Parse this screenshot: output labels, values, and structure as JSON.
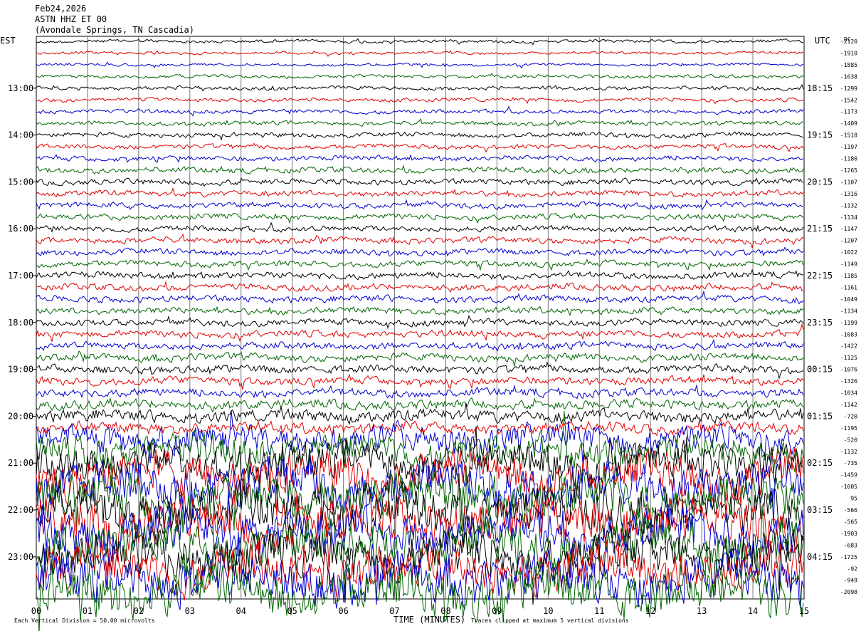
{
  "header": {
    "date": "Feb24,2026",
    "station": "ASTN HHZ ET 00",
    "location": "(Avondale Springs, TN Cascadia)"
  },
  "labels": {
    "left_tz": "EST",
    "right_tz": "UTC",
    "dc": "DC",
    "x_title": "TIME (MINUTES)",
    "footer_left": "Each Vertical Division = 50.00 microvolts",
    "footer_right": "Traces clipped at maximum 5 vertical divisions"
  },
  "chart_data": {
    "type": "line",
    "title": "ASTN HHZ ET 00",
    "xlabel": "TIME (MINUTES)",
    "ylabel": "",
    "xlim": [
      0,
      15
    ],
    "grid": true,
    "x_ticks": [
      "00",
      "01",
      "02",
      "03",
      "04",
      "05",
      "06",
      "07",
      "08",
      "09",
      "10",
      "11",
      "12",
      "13",
      "14",
      "15"
    ],
    "left_time_labels": [
      {
        "row": 4,
        "label": "13:00"
      },
      {
        "row": 8,
        "label": "14:00"
      },
      {
        "row": 12,
        "label": "15:00"
      },
      {
        "row": 16,
        "label": "16:00"
      },
      {
        "row": 20,
        "label": "17:00"
      },
      {
        "row": 24,
        "label": "18:00"
      },
      {
        "row": 28,
        "label": "19:00"
      },
      {
        "row": 32,
        "label": "20:00"
      },
      {
        "row": 36,
        "label": "21:00"
      },
      {
        "row": 40,
        "label": "22:00"
      },
      {
        "row": 44,
        "label": "23:00"
      }
    ],
    "right_time_labels": [
      {
        "row": 4,
        "label": "18:15"
      },
      {
        "row": 8,
        "label": "19:15"
      },
      {
        "row": 12,
        "label": "20:15"
      },
      {
        "row": 16,
        "label": "21:15"
      },
      {
        "row": 20,
        "label": "22:15"
      },
      {
        "row": 24,
        "label": "23:15"
      },
      {
        "row": 28,
        "label": "00:15"
      },
      {
        "row": 32,
        "label": "01:15"
      },
      {
        "row": 36,
        "label": "02:15"
      },
      {
        "row": 40,
        "label": "03:15"
      },
      {
        "row": 44,
        "label": "04:15"
      }
    ],
    "dc_offsets": [
      "-2120",
      "-1910",
      "-1885",
      "-1638",
      "-1299",
      "-1542",
      "-1173",
      "-1409",
      "-1518",
      "-1197",
      "-1180",
      "-1265",
      "-1107",
      "-1316",
      "-1132",
      "-1134",
      "-1147",
      "-1207",
      "-1022",
      "-1149",
      "-1185",
      "-1161",
      "-1049",
      "-1134",
      "-1199",
      "-1083",
      "-1422",
      "-1125",
      "-1076",
      "-1326",
      "-1034",
      "-1142",
      "-720",
      "-1195",
      "-520",
      "-1132",
      "-735",
      "-1459",
      "-1005",
      "95",
      "-566",
      "-565",
      "-1903",
      "-683",
      "-1725",
      "-92",
      "-949",
      "-2098"
    ],
    "series_colors": [
      "#000000",
      "#e00000",
      "#0000d0",
      "#006400"
    ],
    "row_amplitude_divisions": [
      0.35,
      0.3,
      0.3,
      0.35,
      0.4,
      0.4,
      0.45,
      0.45,
      0.5,
      0.5,
      0.55,
      0.6,
      0.6,
      0.6,
      0.6,
      0.6,
      0.6,
      0.65,
      0.65,
      0.65,
      0.7,
      0.7,
      0.7,
      0.7,
      0.7,
      0.75,
      0.75,
      0.8,
      0.85,
      0.85,
      0.9,
      1.0,
      1.3,
      1.2,
      3.0,
      3.5,
      4.0,
      4.5,
      5.0,
      5.0,
      5.0,
      5.0,
      5.0,
      5.0,
      5.0,
      5.0,
      5.0,
      5.0
    ]
  }
}
